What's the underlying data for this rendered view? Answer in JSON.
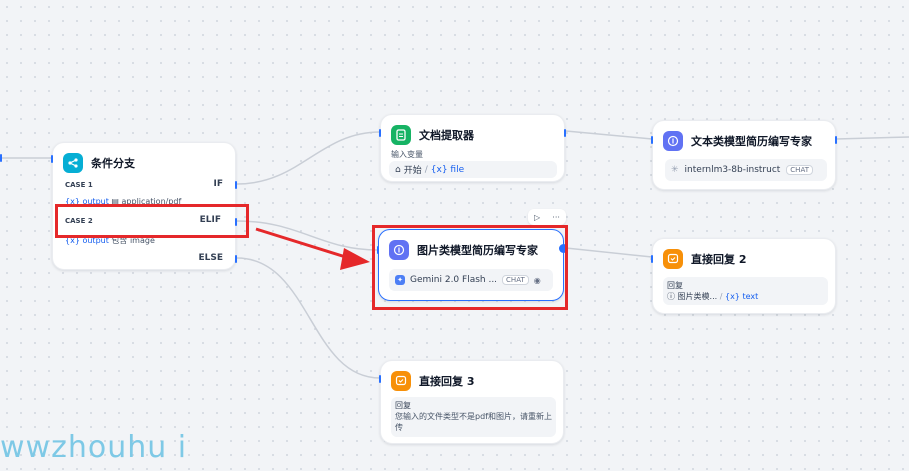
{
  "nodes": {
    "condition": {
      "title": "条件分支",
      "case1_label": "CASE 1",
      "case1_result": "IF",
      "case1_cond_var": "{x}",
      "case1_cond_name": "output",
      "case1_cond_value": "application/pdf",
      "case2_label": "CASE 2",
      "case2_result": "ELIF",
      "case2_cond_var": "{x}",
      "case2_cond_name": "output",
      "case2_cond_op": "包含",
      "case2_cond_value": "image",
      "else_label": "ELSE"
    },
    "doc_extractor": {
      "title": "文档提取器",
      "input_label": "输入变量",
      "start_label": "开始",
      "separator": "/",
      "var_text": "{x} file"
    },
    "text_expert": {
      "title": "文本类模型简历编写专家",
      "model": "internlm3-8b-instruct",
      "mode": "CHAT"
    },
    "image_expert": {
      "title": "图片类模型简历编写专家",
      "model": "Gemini 2.0 Flash ...",
      "mode": "CHAT"
    },
    "reply2": {
      "title": "直接回复 2",
      "label": "回复",
      "source": "图片类模...",
      "separator": "/",
      "var_text": "{x} text"
    },
    "reply3": {
      "title": "直接回复 3",
      "label": "回复",
      "text": "您输入的文件类型不是pdf和图片，请重新上传"
    }
  },
  "toolbar": {
    "play_icon": "▷",
    "more_icon": "···"
  },
  "watermark": "wwzhouhu i",
  "colors": {
    "accent": "#2970ff",
    "condition_icon": "#06aed4",
    "doc_icon": "#16b364",
    "llm_icon": "#6172f3",
    "reply_icon": "#f79009",
    "annotation": "#e5282a"
  }
}
